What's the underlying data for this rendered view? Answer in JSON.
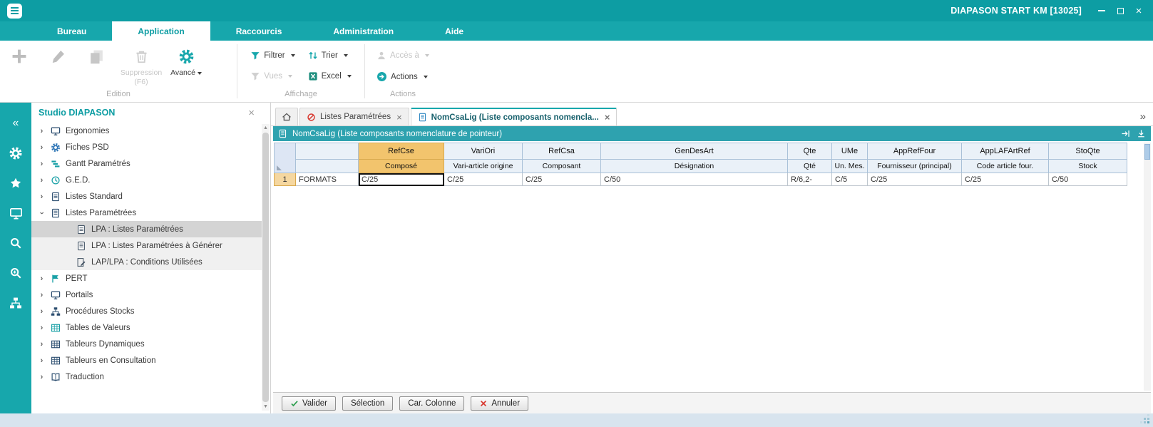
{
  "window": {
    "title": "DIAPASON START KM [13025]",
    "controls": [
      "minimize",
      "maximize",
      "close"
    ]
  },
  "menu": {
    "items": [
      {
        "label": "Bureau",
        "active": false
      },
      {
        "label": "Application",
        "active": true
      },
      {
        "label": "Raccourcis",
        "active": false
      },
      {
        "label": "Administration",
        "active": false
      },
      {
        "label": "Aide",
        "active": false
      }
    ]
  },
  "ribbon": {
    "delete_label": "Suppression (F6)",
    "advanced_label": "Avancé",
    "filter_label": "Filtrer",
    "views_label": "Vues",
    "sort_label": "Trier",
    "excel_label": "Excel",
    "access_label": "Accès à",
    "actions_label": "Actions",
    "group_labels": [
      "Edition",
      "Affichage",
      "Actions"
    ]
  },
  "rail": {
    "icons": [
      "collapse-left",
      "settings",
      "favorites",
      "screens",
      "search",
      "search-advanced",
      "hierarchy"
    ]
  },
  "sidebar": {
    "title": "Studio DIAPASON",
    "items": [
      {
        "label": "Ergonomies",
        "level": 0,
        "state": "collapsed",
        "icon": "monitor",
        "color": "#2B4D6F"
      },
      {
        "label": "Fiches PSD",
        "level": 0,
        "state": "collapsed",
        "icon": "gear",
        "color": "#2E75B6"
      },
      {
        "label": "Gantt Paramétrés",
        "level": 0,
        "state": "collapsed",
        "icon": "gantt",
        "color": "#18A0A6"
      },
      {
        "label": "G.E.D.",
        "level": 0,
        "state": "collapsed",
        "icon": "clock",
        "color": "#18A0A6"
      },
      {
        "label": "Listes Standard",
        "level": 0,
        "state": "collapsed",
        "icon": "document",
        "color": "#2B4D6F"
      },
      {
        "label": "Listes Paramétrées",
        "level": 0,
        "state": "expanded",
        "icon": "document",
        "color": "#2B4D6F"
      },
      {
        "label": "LPA : Listes Paramétrées",
        "level": 1,
        "state": "leaf",
        "icon": "document",
        "color": "#4A5A6A",
        "selected": true
      },
      {
        "label": "LPA : Listes Paramétrées à Générer",
        "level": 1,
        "state": "leaf",
        "icon": "document",
        "color": "#4A5A6A"
      },
      {
        "label": "LAP/LPA : Conditions Utilisées",
        "level": 1,
        "state": "leaf",
        "icon": "pencil-doc",
        "color": "#4A5A6A"
      },
      {
        "label": "PERT",
        "level": 0,
        "state": "collapsed",
        "icon": "flag",
        "color": "#18A0A6"
      },
      {
        "label": "Portails",
        "level": 0,
        "state": "collapsed",
        "icon": "monitor",
        "color": "#2B4D6F"
      },
      {
        "label": "Procédures Stocks",
        "level": 0,
        "state": "collapsed",
        "icon": "hierarchy",
        "color": "#2B4D6F"
      },
      {
        "label": "Tables de Valeurs",
        "level": 0,
        "state": "collapsed",
        "icon": "table",
        "color": "#18A0A6"
      },
      {
        "label": "Tableurs Dynamiques",
        "level": 0,
        "state": "collapsed",
        "icon": "table",
        "color": "#2B4D6F"
      },
      {
        "label": "Tableurs en Consultation",
        "level": 0,
        "state": "collapsed",
        "icon": "table",
        "color": "#2B4D6F"
      },
      {
        "label": "Traduction",
        "level": 0,
        "state": "collapsed",
        "icon": "book",
        "color": "#2B4D6F"
      }
    ]
  },
  "tabs": {
    "items": [
      {
        "icon": "home",
        "label": "",
        "closable": false,
        "active": false
      },
      {
        "icon": "forbidden",
        "label": "Listes Paramétrées",
        "closable": true,
        "active": false
      },
      {
        "icon": "document",
        "label": "NomCsaLig (Liste composants nomencla...",
        "closable": true,
        "active": true
      }
    ]
  },
  "panel": {
    "title": "NomCsaLig (Liste composants nomenclature de pointeur)"
  },
  "grid": {
    "columns": [
      {
        "name": "",
        "desc": "",
        "highlighted": false
      },
      {
        "name": "RefCse",
        "desc": "Composé",
        "highlighted": true
      },
      {
        "name": "VariOri",
        "desc": "Vari-article origine",
        "highlighted": false
      },
      {
        "name": "RefCsa",
        "desc": "Composant",
        "highlighted": false
      },
      {
        "name": "GenDesArt",
        "desc": "Désignation",
        "highlighted": false
      },
      {
        "name": "Qte",
        "desc": "Qté",
        "highlighted": false
      },
      {
        "name": "UMe",
        "desc": "Un. Mes.",
        "highlighted": false
      },
      {
        "name": "AppRefFour",
        "desc": "Fournisseur (principal)",
        "highlighted": false
      },
      {
        "name": "AppLAFArtRef",
        "desc": "Code article four.",
        "highlighted": false
      },
      {
        "name": "StoQte",
        "desc": "Stock",
        "highlighted": false
      }
    ],
    "rows": [
      {
        "num": "1",
        "cells": [
          "FORMATS",
          "C/25",
          "C/25",
          "C/25",
          "C/50",
          "R/6,2-",
          "C/5",
          "C/25",
          "C/25",
          "C/50"
        ]
      }
    ],
    "editing": {
      "row": 0,
      "col": 1
    }
  },
  "footer": {
    "buttons": [
      {
        "label": "Valider",
        "icon": "check"
      },
      {
        "label": "Sélection",
        "icon": ""
      },
      {
        "label": "Car. Colonne",
        "icon": ""
      },
      {
        "label": "Annuler",
        "icon": "cancel"
      }
    ]
  },
  "colors": {
    "teal": "#17A7AC",
    "teal_dark": "#0D9DA3",
    "header_highlight": "#F2C46D",
    "row_number_bg": "#F5D7A0"
  }
}
